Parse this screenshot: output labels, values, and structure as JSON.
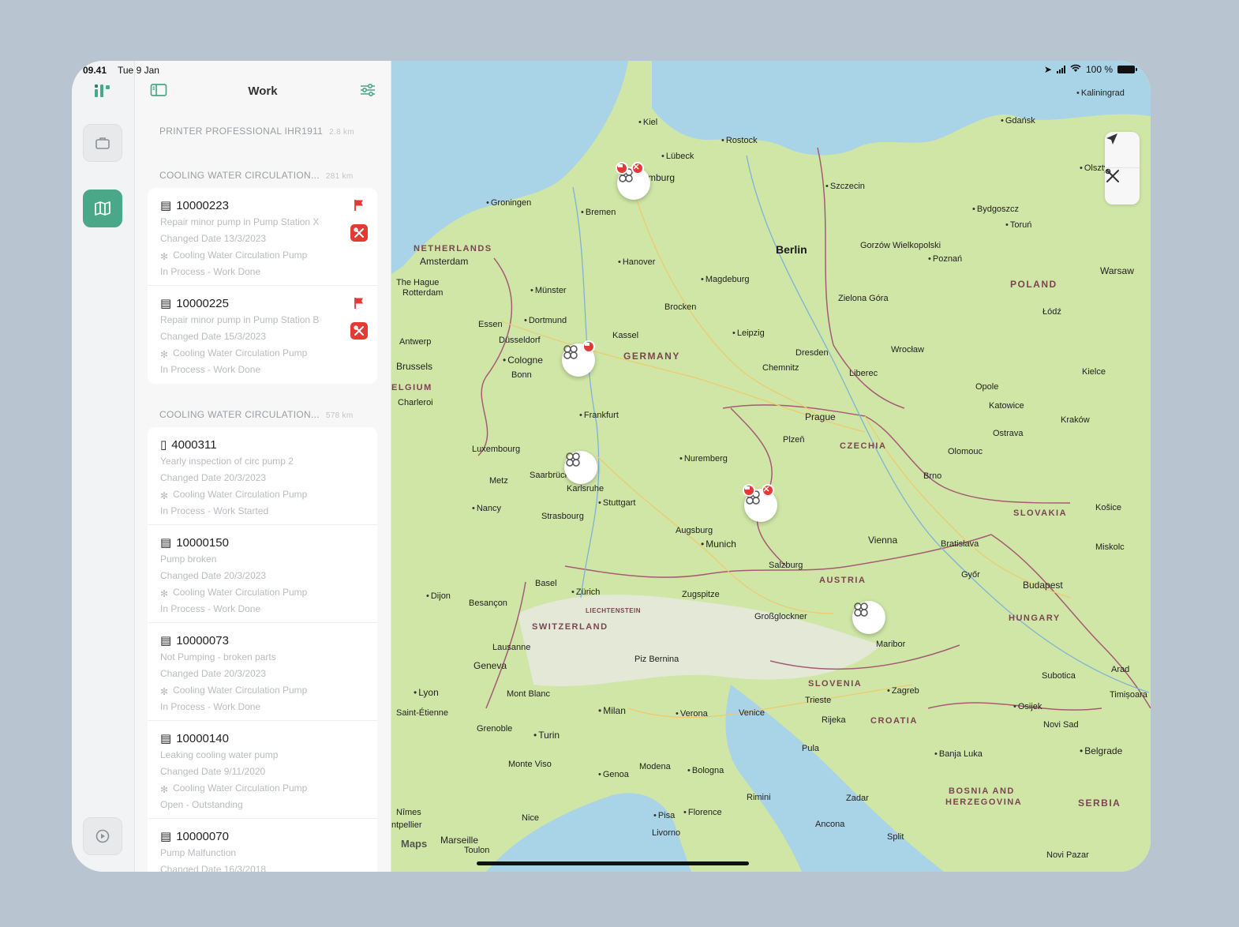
{
  "status_bar": {
    "time": "09.41",
    "date": "Tue 9 Jan",
    "battery": "100 %"
  },
  "panel": {
    "title": "Work"
  },
  "groups": [
    {
      "title": "PRINTER PROFESSIONAL IHR1911",
      "distance": "2.8 km"
    },
    {
      "title": "COOLING WATER CIRCULATION...",
      "distance": "281 km",
      "items": [
        {
          "id": "10000223",
          "desc": "Repair minor pump in Pump Station X",
          "date": "Changed Date 13/3/2023",
          "asset": "Cooling Water Circulation Pump",
          "status": "In Process - Work Done",
          "flag": true,
          "tool": true
        },
        {
          "id": "10000225",
          "desc": "Repair minor pump in Pump Station B",
          "date": "Changed Date 15/3/2023",
          "asset": "Cooling Water Circulation Pump",
          "status": "In Process - Work Done",
          "flag": true,
          "tool": true
        }
      ]
    },
    {
      "title": "COOLING WATER CIRCULATION...",
      "distance": "578 km",
      "items": [
        {
          "id": "4000311",
          "desc": "Yearly inspection of circ pump 2",
          "date": "Changed Date 20/3/2023",
          "asset": "Cooling Water Circulation Pump",
          "status": "In Process - Work Started"
        },
        {
          "id": "10000150",
          "desc": "Pump broken",
          "date": "Changed Date 20/3/2023",
          "asset": "Cooling Water Circulation Pump",
          "status": "In Process - Work Done"
        },
        {
          "id": "10000073",
          "desc": "Not Pumping - broken parts",
          "date": "Changed Date 20/3/2023",
          "asset": "Cooling Water Circulation Pump",
          "status": "In Process - Work Done"
        },
        {
          "id": "10000140",
          "desc": "Leaking cooling water pump",
          "date": "Changed Date 9/11/2020",
          "asset": "Cooling Water Circulation Pump",
          "status": "Open - Outstanding"
        },
        {
          "id": "10000070",
          "desc": "Pump Malfunction",
          "date": "Changed Date 16/3/2018",
          "asset": "",
          "status": ""
        }
      ]
    }
  ],
  "map": {
    "attribution": "Maps",
    "cities": [
      {
        "name": "Kiel",
        "size": "s"
      },
      {
        "name": "Rostock",
        "size": "s"
      },
      {
        "name": "Lübeck",
        "size": "s"
      },
      {
        "name": "mburg",
        "size": "m"
      },
      {
        "name": "Szczecin",
        "size": "s"
      },
      {
        "name": "Gdańsk",
        "size": "s"
      },
      {
        "name": "Kaliningrad",
        "size": "s"
      },
      {
        "name": "Groningen",
        "size": "s"
      },
      {
        "name": "Bremen",
        "size": "s"
      },
      {
        "name": "Bydgoszcz",
        "size": "s"
      },
      {
        "name": "Toruń",
        "size": "s"
      },
      {
        "name": "Amsterdam",
        "size": "m"
      },
      {
        "name": "Hanover",
        "size": "s"
      },
      {
        "name": "Berlin",
        "size": "b"
      },
      {
        "name": "Poznań",
        "size": "s"
      },
      {
        "name": "Warsaw",
        "size": "m"
      },
      {
        "name": "The Hague",
        "size": "s"
      },
      {
        "name": "Rotterdam",
        "size": "s"
      },
      {
        "name": "Magdeburg",
        "size": "s"
      },
      {
        "name": "Münster",
        "size": "s"
      },
      {
        "name": "Zielona Góra",
        "size": "s"
      },
      {
        "name": "Łódź",
        "size": "s"
      },
      {
        "name": "Essen",
        "size": "s"
      },
      {
        "name": "Dortmund",
        "size": "s"
      },
      {
        "name": "Antwerp",
        "size": "s"
      },
      {
        "name": "Düsseldorf",
        "size": "s"
      },
      {
        "name": "Kassel",
        "size": "s"
      },
      {
        "name": "Leipzig",
        "size": "s"
      },
      {
        "name": "Brussels",
        "size": "m"
      },
      {
        "name": "Cologne",
        "size": "m"
      },
      {
        "name": "Dresden",
        "size": "s"
      },
      {
        "name": "Wrocław",
        "size": "s"
      },
      {
        "name": "Bonn",
        "size": "s"
      },
      {
        "name": "Chemnitz",
        "size": "s"
      },
      {
        "name": "Liberec",
        "size": "s"
      },
      {
        "name": "Opole",
        "size": "s"
      },
      {
        "name": "Kielce",
        "size": "s"
      },
      {
        "name": "Charleroi",
        "size": "s"
      },
      {
        "name": "Katowice",
        "size": "s"
      },
      {
        "name": "Frankfurt",
        "size": "s"
      },
      {
        "name": "Prague",
        "size": "m"
      },
      {
        "name": "Kraków",
        "size": "s"
      },
      {
        "name": "Ostrava",
        "size": "s"
      },
      {
        "name": "Plzeň",
        "size": "s"
      },
      {
        "name": "Luxembourg",
        "size": "s"
      },
      {
        "name": "Nuremberg",
        "size": "s"
      },
      {
        "name": "Olomouc",
        "size": "s"
      },
      {
        "name": "Saarbrücken",
        "size": "s"
      },
      {
        "name": "Metz",
        "size": "s"
      },
      {
        "name": "Brno",
        "size": "s"
      },
      {
        "name": "Karlsruhe",
        "size": "s"
      },
      {
        "name": "Stuttgart",
        "size": "s"
      },
      {
        "name": "Nancy",
        "size": "s"
      },
      {
        "name": "Košice",
        "size": "s"
      },
      {
        "name": "Strasbourg",
        "size": "s"
      },
      {
        "name": "Augsburg",
        "size": "s"
      },
      {
        "name": "Munich",
        "size": "m"
      },
      {
        "name": "Vienna",
        "size": "m"
      },
      {
        "name": "Bratislava",
        "size": "s"
      },
      {
        "name": "Miskolc",
        "size": "s"
      },
      {
        "name": "Salzburg",
        "size": "s"
      },
      {
        "name": "Basel",
        "size": "s"
      },
      {
        "name": "Zürich",
        "size": "s"
      },
      {
        "name": "Győr",
        "size": "s"
      },
      {
        "name": "Dijon",
        "size": "s"
      },
      {
        "name": "Budapest",
        "size": "m"
      },
      {
        "name": "Besançon",
        "size": "s"
      },
      {
        "name": "Zugspitze",
        "size": "s"
      },
      {
        "name": "Großglockner",
        "size": "s"
      },
      {
        "name": "Lausanne",
        "size": "s"
      },
      {
        "name": "Piz Bernina",
        "size": "s"
      },
      {
        "name": "Maribor",
        "size": "s"
      },
      {
        "name": "Geneva",
        "size": "s"
      },
      {
        "name": "Subotica",
        "size": "s"
      },
      {
        "name": "Arad",
        "size": "s"
      },
      {
        "name": "Lyon",
        "size": "m"
      },
      {
        "name": "Mont Blanc",
        "size": "s"
      },
      {
        "name": "Trieste",
        "size": "s"
      },
      {
        "name": "Zagreb",
        "size": "s"
      },
      {
        "name": "Timișoara",
        "size": "s"
      },
      {
        "name": "Saint-Étienne",
        "size": "s"
      },
      {
        "name": "Milan",
        "size": "m"
      },
      {
        "name": "Verona",
        "size": "s"
      },
      {
        "name": "Venice",
        "size": "s"
      },
      {
        "name": "Rijeka",
        "size": "s"
      },
      {
        "name": "Osijek",
        "size": "s"
      },
      {
        "name": "Grenoble",
        "size": "s"
      },
      {
        "name": "Novi Sad",
        "size": "s"
      },
      {
        "name": "Turin",
        "size": "m"
      },
      {
        "name": "Pula",
        "size": "s"
      },
      {
        "name": "Belgrade",
        "size": "m"
      },
      {
        "name": "Banja Luka",
        "size": "s"
      },
      {
        "name": "Monte Viso",
        "size": "s"
      },
      {
        "name": "Modena",
        "size": "s"
      },
      {
        "name": "Bologna",
        "size": "s"
      },
      {
        "name": "Genoa",
        "size": "s"
      },
      {
        "name": "Rimini",
        "size": "s"
      },
      {
        "name": "Zadar",
        "size": "s"
      },
      {
        "name": "Nice",
        "size": "s"
      },
      {
        "name": "Pisa",
        "size": "s"
      },
      {
        "name": "Florence",
        "size": "s"
      },
      {
        "name": "Ancona",
        "size": "s"
      },
      {
        "name": "Marseille",
        "size": "m"
      },
      {
        "name": "Toulon",
        "size": "s"
      },
      {
        "name": "Livorno",
        "size": "s"
      },
      {
        "name": "Split",
        "size": "s"
      },
      {
        "name": "Novi Pazar",
        "size": "s"
      },
      {
        "name": "Nîmes",
        "size": "s"
      },
      {
        "name": "ntpellier",
        "size": "s"
      },
      {
        "name": "Brocken",
        "size": "s"
      },
      {
        "name": "Gorzów Wielkopolski",
        "size": "s"
      },
      {
        "name": "Olsztyn",
        "size": "s"
      }
    ],
    "countries": [
      "NETHERLANDS",
      "GERMANY",
      "POLAND",
      "ELGIUM",
      "CZECHIA",
      "SLOVAKIA",
      "AUSTRIA",
      "HUNGARY",
      "SWITZERLAND",
      "LIECHTENSTEIN",
      "SLOVENIA",
      "CROATIA",
      "BOSNIA AND",
      "HERZEGOVINA",
      "SERBIA"
    ]
  }
}
